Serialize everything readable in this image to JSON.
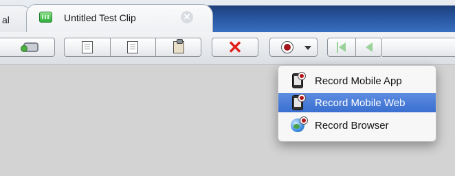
{
  "tabs": [
    {
      "label": "al",
      "active": false
    },
    {
      "label": "Untitled Test Clip",
      "active": true
    }
  ],
  "tab_close_glyph": "✕",
  "toolbar": {
    "buttons": [
      "camera-icon",
      "new-doc-icon",
      "copy-icon",
      "paste-icon",
      "delete-x-icon",
      "record-icon",
      "skip-back-icon",
      "step-back-icon"
    ],
    "delete_glyph": "✕"
  },
  "record_menu": {
    "items": [
      {
        "label": "Record Mobile App",
        "icon": "mobile-app-icon",
        "selected": false
      },
      {
        "label": "Record Mobile Web",
        "icon": "mobile-web-icon",
        "selected": true
      },
      {
        "label": "Record Browser",
        "icon": "browser-globe-icon",
        "selected": false
      }
    ]
  },
  "colors": {
    "accent": "#3a6fd0",
    "tab_strip": "#2a5aa6",
    "record_red": "#b3141a",
    "delete_red": "#e2201b",
    "content_bg": "#d3d3d3"
  }
}
